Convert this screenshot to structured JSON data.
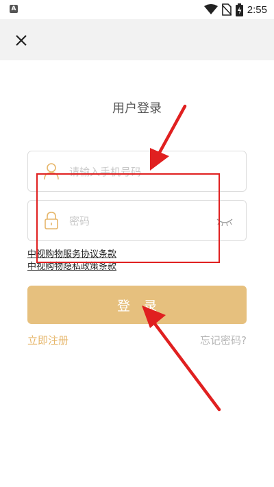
{
  "status_bar": {
    "app_badge": "A",
    "time": "2:55"
  },
  "header": {
    "close_icon": "close-icon"
  },
  "login": {
    "title": "用户登录",
    "phone_placeholder": "请输入手机号码",
    "password_placeholder": "密码",
    "terms_service": "中视购物服务协议条款",
    "terms_privacy": "中视购物隐私政策条款",
    "login_button": "登录",
    "register_link": "立即注册",
    "forgot_link": "忘记密码?"
  },
  "colors": {
    "accent": "#e6c07e",
    "register_text": "#e6b66a",
    "annotation": "#e02020"
  },
  "icons": [
    "user-icon",
    "lock-icon",
    "eye-closed-icon",
    "wifi-icon",
    "no-sim-icon",
    "battery-icon"
  ]
}
